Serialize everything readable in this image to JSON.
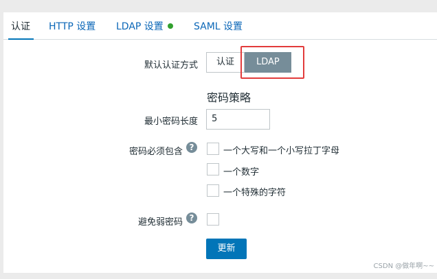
{
  "tabs": [
    {
      "label": "认证",
      "active": true
    },
    {
      "label": "HTTP 设置",
      "active": false
    },
    {
      "label": "LDAP 设置",
      "active": false,
      "status_dot": true,
      "status_color": "#31a02e"
    },
    {
      "label": "SAML 设置",
      "active": false
    }
  ],
  "form": {
    "default_auth_label": "默认认证方式",
    "auth_options": [
      "认证",
      "LDAP"
    ],
    "auth_selected": "LDAP",
    "password_policy_title": "密码策略",
    "min_length_label": "最小密码长度",
    "min_length_value": "5",
    "must_contain_label": "密码必须包含",
    "must_contain_help": "?",
    "must_contain_options": [
      {
        "label": "一个大写和一个小写拉丁字母",
        "checked": false
      },
      {
        "label": "一个数字",
        "checked": false
      },
      {
        "label": "一个特殊的字符",
        "checked": false
      }
    ],
    "avoid_weak_label": "避免弱密码",
    "avoid_weak_help": "?",
    "avoid_weak_checked": false,
    "update_button": "更新"
  },
  "watermark": "CSDN @做年啊~~",
  "colors": {
    "accent": "#0275b8",
    "selected_toggle": "#768d99",
    "highlight_box": "#e23b3b",
    "link": "#0a66b7"
  }
}
